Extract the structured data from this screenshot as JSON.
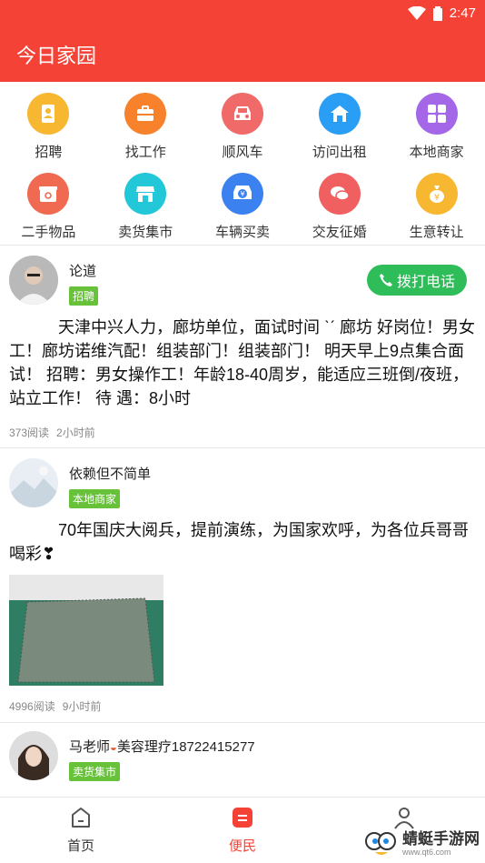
{
  "status": {
    "time": "2:47"
  },
  "header": {
    "title": "今日家园"
  },
  "categories": [
    {
      "label": "招聘",
      "icon": "person-badge-icon",
      "color": "#f7b731"
    },
    {
      "label": "找工作",
      "icon": "briefcase-icon",
      "color": "#f7822b"
    },
    {
      "label": "顺风车",
      "icon": "car-icon",
      "color": "#f06a6a"
    },
    {
      "label": "访问出租",
      "icon": "house-icon",
      "color": "#2a9df4"
    },
    {
      "label": "本地商家",
      "icon": "grid-icon",
      "color": "#a367e8"
    },
    {
      "label": "二手物品",
      "icon": "box-icon",
      "color": "#f06a52"
    },
    {
      "label": "卖货集市",
      "icon": "shop-icon",
      "color": "#22c7d8"
    },
    {
      "label": "车辆买卖",
      "icon": "car-yen-icon",
      "color": "#3b82f0"
    },
    {
      "label": "交友征婚",
      "icon": "chat-bubbles-icon",
      "color": "#f16060"
    },
    {
      "label": "生意转让",
      "icon": "money-bag-icon",
      "color": "#f7b731"
    }
  ],
  "posts": [
    {
      "name": "论道",
      "tag": "招聘",
      "call_label": "拨打电话",
      "text": "　　　天津中兴人力，廊坊单位，面试时间 ˋˊ 廊坊 好岗位！男女工！廊坊诺维汽配！组装部门！组装部门！ 明天早上9点集合面试！ 招聘：男女操作工！年龄18-40周岁，能适应三班倒/夜班，站立工作！ 待 遇：8小时",
      "reads": "373阅读",
      "time": "2小时前"
    },
    {
      "name": "依赖但不简单",
      "tag": "本地商家",
      "text": "　　　70年国庆大阅兵，提前演练，为国家欢呼，为各位兵哥哥喝彩❣",
      "reads": "4996阅读",
      "time": "9小时前"
    },
    {
      "name": "马老师",
      "name_extra": "美容理疗18722415277",
      "tag": "卖货集市"
    }
  ],
  "nav": [
    {
      "label": "首页",
      "icon": "home-icon"
    },
    {
      "label": "便民",
      "icon": "service-icon"
    },
    {
      "label": "",
      "icon": "user-icon"
    }
  ],
  "watermark": {
    "text": "蜻蜓手游网",
    "url": "www.qt6.com"
  }
}
